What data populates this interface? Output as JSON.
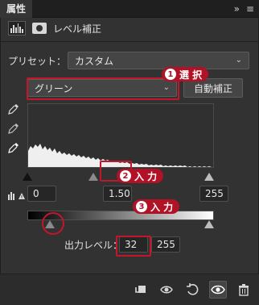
{
  "tab": {
    "title": "属性",
    "chevrons": "»",
    "menu": "≡"
  },
  "header": {
    "title": "レベル補正"
  },
  "preset": {
    "label": "プリセット：",
    "value": "カスタム"
  },
  "channel": {
    "value": "グリーン",
    "auto_button": "自動補正"
  },
  "input_levels": {
    "black": "0",
    "mid": "1.50",
    "white": "255"
  },
  "output_levels": {
    "label": "出力レベル：",
    "black": "32",
    "white": "255"
  },
  "annotations": [
    {
      "num": "1",
      "text": "選 択"
    },
    {
      "num": "2",
      "text": "入 力"
    },
    {
      "num": "3",
      "text": "入 力"
    }
  ],
  "colors": {
    "panel_bg": "#323232",
    "highlight_red": "#c3162b",
    "badge_red": "#b11226"
  },
  "icons": [
    "levels-histogram-icon",
    "mask-icon",
    "eyedropper-black-icon",
    "eyedropper-gray-icon",
    "eyedropper-white-icon",
    "clipping-warning-icon",
    "clip-to-layer-icon",
    "view-previous-state-icon",
    "reset-icon",
    "visibility-eye-icon",
    "trash-icon"
  ]
}
